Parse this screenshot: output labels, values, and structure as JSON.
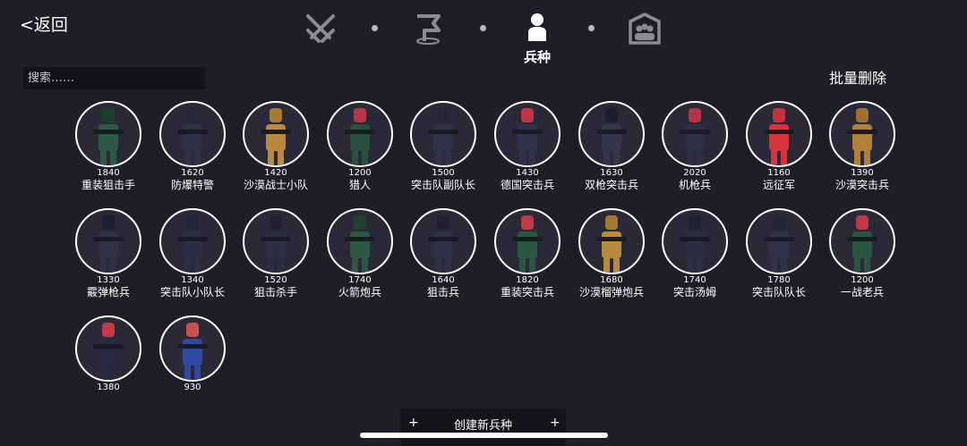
{
  "header": {
    "back_label": "<返回",
    "nav": {
      "items": [
        {
          "icon": "crossed-swords-icon"
        },
        {
          "icon": "flag-icon"
        },
        {
          "icon": "person-icon",
          "label": "兵种",
          "active": true
        },
        {
          "icon": "group-icon"
        }
      ],
      "active_label": "兵种"
    }
  },
  "search": {
    "placeholder": "搜索……"
  },
  "batch_delete_label": "批量删除",
  "units": [
    {
      "cost": "1840",
      "name": "重装狙击手",
      "color": "#2c5a46",
      "head": "#1d3d30"
    },
    {
      "cost": "1620",
      "name": "防爆特警",
      "color": "#2e3046",
      "head": "#262839"
    },
    {
      "cost": "1420",
      "name": "沙漠战士小队",
      "color": "#b8893e",
      "head": "#a87a32"
    },
    {
      "cost": "1200",
      "name": "猎人",
      "color": "#27503e",
      "head": "#b83543"
    },
    {
      "cost": "1500",
      "name": "突击队副队长",
      "color": "#30324a",
      "head": "#25263a"
    },
    {
      "cost": "1430",
      "name": "德国突击兵",
      "color": "#2f3249",
      "head": "#c03848"
    },
    {
      "cost": "1630",
      "name": "双枪突击兵",
      "color": "#33354b",
      "head": "#1e1f2c"
    },
    {
      "cost": "2020",
      "name": "机枪兵",
      "color": "#2d2f45",
      "head": "#b83545"
    },
    {
      "cost": "1160",
      "name": "远征军",
      "color": "#d9343e",
      "head": "#c43240"
    },
    {
      "cost": "1390",
      "name": "沙漠突击兵",
      "color": "#b07f3a",
      "head": "#9d7030"
    },
    {
      "cost": "1330",
      "name": "霰弹枪兵",
      "color": "#2f3147",
      "head": "#1e1f2c"
    },
    {
      "cost": "1340",
      "name": "突击队小队长",
      "color": "#2c2e46",
      "head": "#23243a"
    },
    {
      "cost": "1520",
      "name": "狙击杀手",
      "color": "#2c2e44",
      "head": "#1f2030"
    },
    {
      "cost": "1740",
      "name": "火箭炮兵",
      "color": "#2d5844",
      "head": "#21412f"
    },
    {
      "cost": "1640",
      "name": "狙击兵",
      "color": "#2e3046",
      "head": "#1f2030"
    },
    {
      "cost": "1820",
      "name": "重装突击兵",
      "color": "#2b5642",
      "head": "#c23a48"
    },
    {
      "cost": "1680",
      "name": "沙漠榴弹炮兵",
      "color": "#b8893e",
      "head": "#a57832"
    },
    {
      "cost": "1740",
      "name": "突击汤姆",
      "color": "#2c2e44",
      "head": "#1f2030"
    },
    {
      "cost": "1780",
      "name": "突击队队长",
      "color": "#30324a",
      "head": "#222333"
    },
    {
      "cost": "1200",
      "name": "一战老兵",
      "color": "#2a5541",
      "head": "#bf3947"
    },
    {
      "cost": "1380",
      "name": "",
      "color": "#262a44",
      "head": "#c43a48"
    },
    {
      "cost": "930",
      "name": "",
      "color": "#2f4aa0",
      "head": "#c85050"
    }
  ],
  "create_button": {
    "label": "创建新兵种",
    "left_plus": "+",
    "right_plus": "+"
  }
}
